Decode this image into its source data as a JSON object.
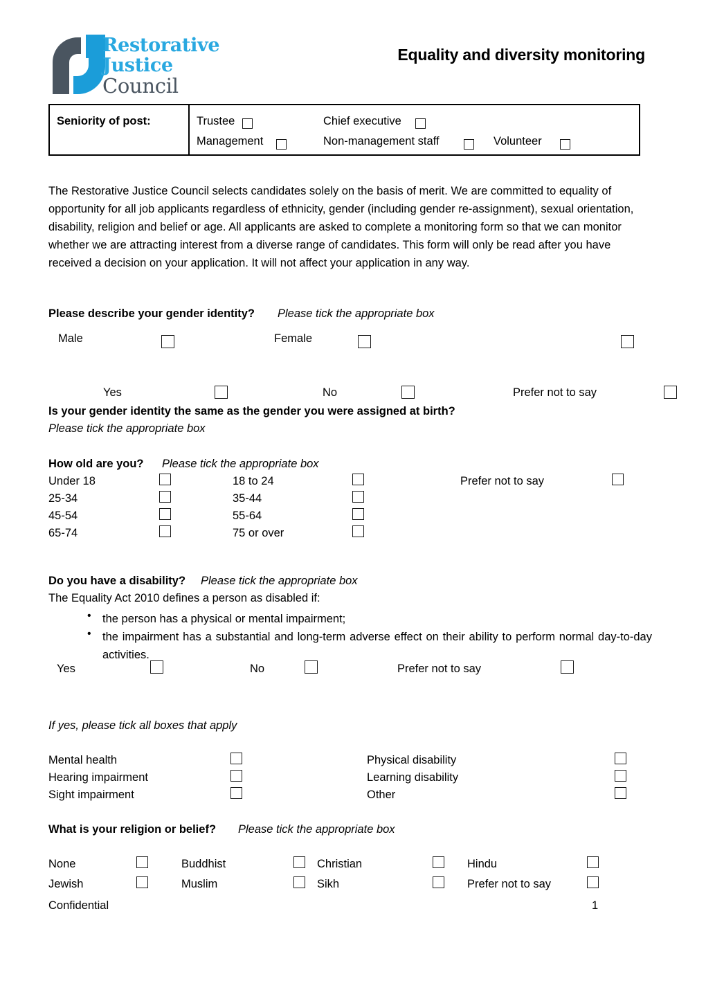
{
  "document": {
    "title": "Equality and diversity monitoring",
    "logo": {
      "line1": "Restorative",
      "line2": "Justice",
      "line3": "Council",
      "mark_name": "restorative-justice-council-monogram",
      "blue": "#29a8e0",
      "gray": "#4a5560"
    },
    "footer": {
      "left": "Confidential",
      "right": "1"
    }
  },
  "seniority": {
    "label": "Seniority of post:",
    "options": [
      {
        "label": "Trustee"
      },
      {
        "label": "Chief executive"
      },
      {
        "label": "Management"
      },
      {
        "label": "Non-management staff"
      },
      {
        "label": "Volunteer"
      }
    ]
  },
  "intro": {
    "text": "The Restorative Justice Council selects candidates solely on the basis of merit. We are committed to equality of opportunity for all job applicants regardless of ethnicity, gender (including gender re-assignment), sexual orientation, disability, religion and belief or age.  All applicants are asked to complete a monitoring form so that we can monitor whether we are attracting interest from a diverse range of candidates. This form will only be read after you have received a decision on your application. It will not affect your application in any way."
  },
  "gender_identity": {
    "question": "Please describe your gender identity?",
    "instruction": "Please tick the appropriate box",
    "options": [
      {
        "label": "Male"
      },
      {
        "label": "Female"
      },
      {
        "label": ""
      }
    ]
  },
  "gender_same_as_birth": {
    "question": "Is your gender identity the same as the gender you were assigned at birth?",
    "instruction": "Please tick the appropriate box",
    "options": [
      {
        "label": "Yes"
      },
      {
        "label": "No"
      },
      {
        "label": "Prefer not to say"
      }
    ]
  },
  "age": {
    "question": "How old are you?",
    "instruction": "Please tick the appropriate box",
    "col1": [
      {
        "label": "Under 18"
      },
      {
        "label": "25-34"
      },
      {
        "label": "45-54"
      },
      {
        "label": "65-74"
      }
    ],
    "col2": [
      {
        "label": "18 to 24"
      },
      {
        "label": "35-44"
      },
      {
        "label": "55-64"
      },
      {
        "label": "75 or over"
      }
    ],
    "col3": [
      {
        "label": "Prefer not to say"
      }
    ]
  },
  "disability": {
    "question": "Do you have a disability?",
    "instruction": "Please tick the appropriate box",
    "definition_intro": "The Equality Act 2010 defines a person as disabled if:",
    "bullets": [
      "the person has a physical or mental impairment;",
      "the impairment has a substantial and long-term adverse effect on their ability to perform normal day-to-day activities."
    ],
    "options": [
      {
        "label": "Yes"
      },
      {
        "label": "No"
      },
      {
        "label": "Prefer not to say"
      }
    ]
  },
  "disability_types": {
    "instruction": "If yes, please tick all boxes that apply",
    "col1": [
      {
        "label": "Mental health"
      },
      {
        "label": "Hearing impairment"
      },
      {
        "label": "Sight impairment"
      }
    ],
    "col2": [
      {
        "label": "Physical disability"
      },
      {
        "label": "Learning disability"
      },
      {
        "label": "Other"
      }
    ]
  },
  "religion": {
    "question": "What is your religion or belief?",
    "instruction": "Please tick the appropriate box",
    "row1": [
      {
        "label": "None"
      },
      {
        "label": "Buddhist"
      },
      {
        "label": "Christian"
      },
      {
        "label": "Hindu"
      }
    ],
    "row2": [
      {
        "label": "Jewish"
      },
      {
        "label": "Muslim"
      },
      {
        "label": "Sikh"
      },
      {
        "label": "Prefer not to say"
      }
    ]
  }
}
